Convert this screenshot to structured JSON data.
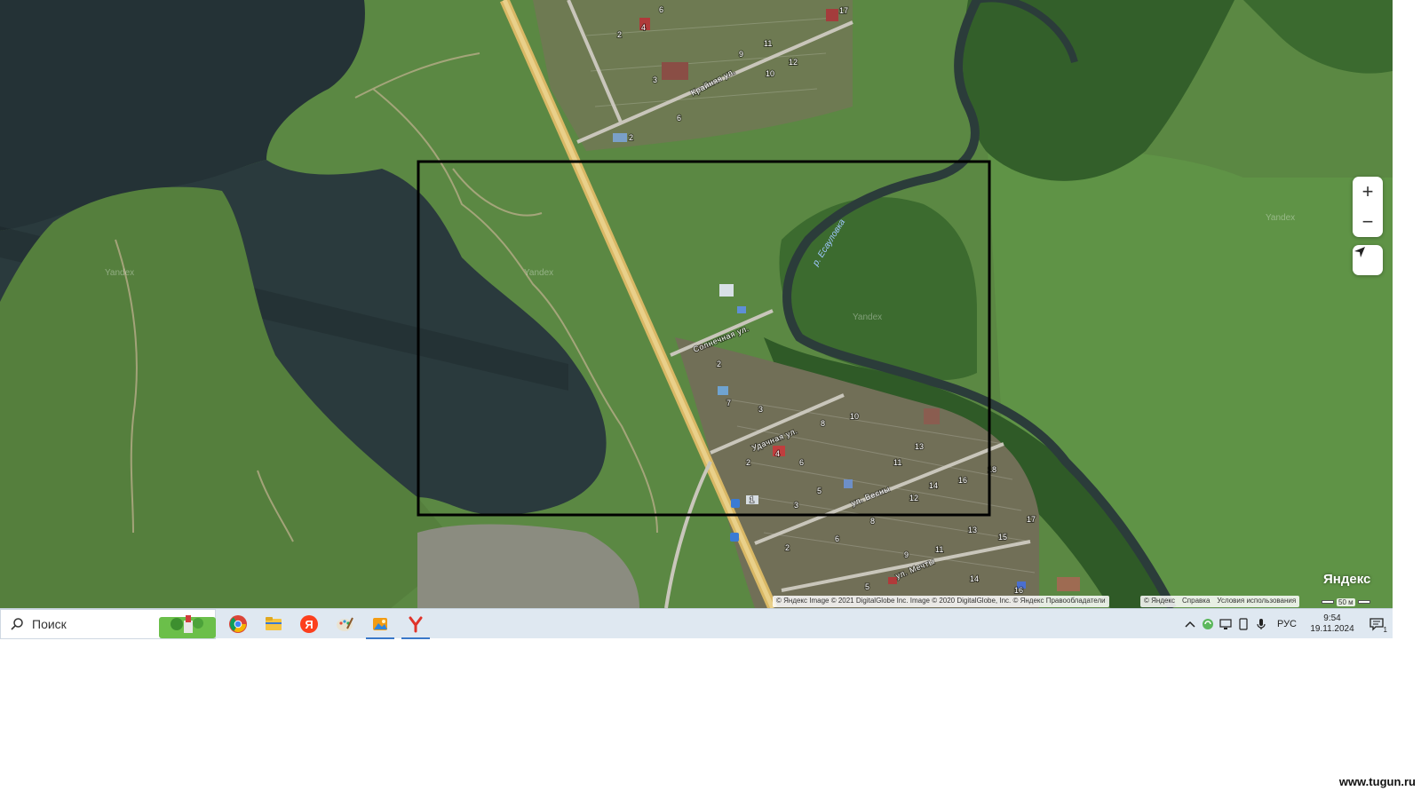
{
  "map": {
    "streets": [
      "Крайняя ул.",
      "Солнечная ул.",
      "Удачная ул.",
      "ул. Весны",
      "ул. Мечты"
    ],
    "river": "р. Есауловка",
    "watermarks": [
      "Yandex",
      "Yandex",
      "Yandex",
      "Yandex"
    ],
    "house_numbers": [
      "6",
      "2",
      "4",
      "9",
      "11",
      "10",
      "12",
      "17",
      "3",
      "6",
      "2",
      "2",
      "3",
      "4",
      "6",
      "8",
      "10",
      "13",
      "11",
      "14",
      "16",
      "18",
      "2",
      "5",
      "3",
      "1",
      "12",
      "8",
      "7",
      "2",
      "6",
      "9",
      "11",
      "13",
      "15",
      "14",
      "16",
      "5",
      "17"
    ],
    "selection_rect": "black",
    "zoom_in_label": "+",
    "zoom_out_label": "−",
    "attribution": "© Яндекс Image © 2021 DigitalGlobe Inc. Image © 2020 DigitalGlobe, Inc. © Яндекс  Правообладатели",
    "attribution_links": [
      "© Яндекс",
      "Справка",
      "Условия использования"
    ],
    "scale_label": "50 м",
    "logo": "Яндекс"
  },
  "taskbar": {
    "search_placeholder": "Поиск",
    "apps": [
      {
        "name": "chrome-icon",
        "active": false
      },
      {
        "name": "file-explorer-icon",
        "active": false
      },
      {
        "name": "yandex-browser-icon",
        "active": false
      },
      {
        "name": "paint-icon",
        "active": false
      },
      {
        "name": "photos-icon",
        "active": true
      },
      {
        "name": "yandex-y-icon",
        "active": true
      }
    ],
    "language": "РУС",
    "time": "9:54",
    "date": "19.11.2024",
    "notification_count": "1"
  },
  "site_watermark": "www.tugun.ru",
  "colors": {
    "taskbar_bg": "#dfe8f1",
    "accent": "#3a78c9",
    "highway": "#e6c26a",
    "water": "#2c3a3f",
    "field": "#5d8a45"
  }
}
